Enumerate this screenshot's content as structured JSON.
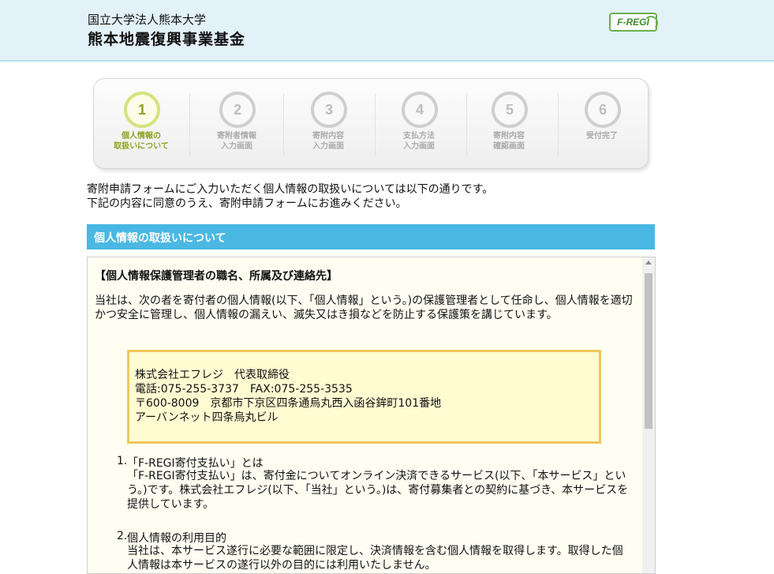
{
  "header": {
    "org_name": "国立大学法人熊本大学",
    "fund_name": "熊本地震復興事業基金",
    "logo_text": "F-REGI"
  },
  "steps": [
    {
      "number": "1",
      "label": "個人情報の\n取扱いについて",
      "active": true
    },
    {
      "number": "2",
      "label": "寄附者情報\n入力画面",
      "active": false
    },
    {
      "number": "3",
      "label": "寄附内容\n入力画面",
      "active": false
    },
    {
      "number": "4",
      "label": "支払方法\n入力画面",
      "active": false
    },
    {
      "number": "5",
      "label": "寄附内容\n確認画面",
      "active": false
    },
    {
      "number": "6",
      "label": "受付完了",
      "active": false
    }
  ],
  "intro": {
    "line1": "寄附申請フォームにご入力いただく個人情報の取扱いについては以下の通りです。",
    "line2": "下記の内容に同意のうえ、寄附申請フォームにお進みください。"
  },
  "section": {
    "title": "個人情報の取扱いについて"
  },
  "content": {
    "heading": "【個人情報保護管理者の職名、所属及び連絡先】",
    "paragraph": "当社は、次の者を寄付者の個人情報(以下、「個人情報」という。)の保護管理者として任命し、個人情報を適切かつ安全に管理し、個人情報の漏えい、滅失又はき損などを防止する保護策を講じています。",
    "address": {
      "line1": "株式会社エフレジ　代表取締役",
      "line2": "電話:075-255-3737　FAX:075-255-3535",
      "line3": "〒600-8009　京都市下京区四条通烏丸西入函谷鉾町101番地",
      "line4": "アーバンネット四条烏丸ビル"
    },
    "items": [
      {
        "num": "1.",
        "title": "「F-REGI寄付支払い」とは",
        "body": "「F-REGI寄付支払い」は、寄付金についてオンライン決済できるサービス(以下、「本サービス」という。)です。株式会社エフレジ(以下、「当社」という。)は、寄付募集者との契約に基づき、本サービスを提供しています。"
      },
      {
        "num": "2.",
        "title": "個人情報の利用目的",
        "body": "当社は、本サービス遂行に必要な範囲に限定し、決済情報を含む個人情報を取得します。取得した個人情報は本サービスの遂行以外の目的には利用いたしません。"
      }
    ]
  },
  "colors": {
    "header_bg": "#e3f1f9",
    "section_bar": "#4ab8e3",
    "active_step": "#8da21f",
    "address_border": "#f0c65a",
    "content_bg": "#fefef2"
  }
}
